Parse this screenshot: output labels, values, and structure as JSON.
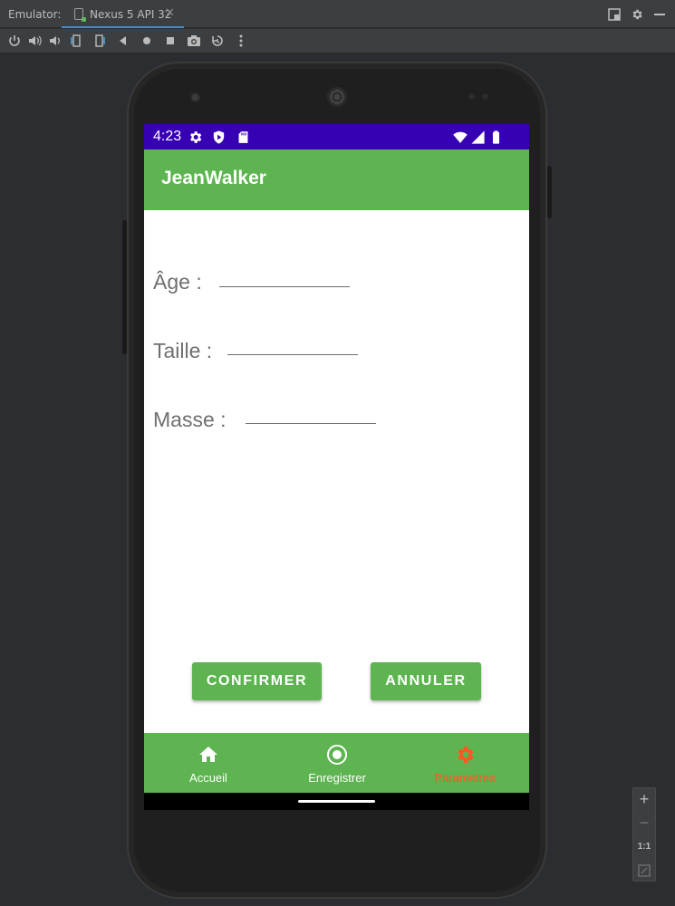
{
  "window": {
    "emulator_label": "Emulator:",
    "tab_label": "Nexus 5 API 32",
    "tab_close": "✕"
  },
  "toolbar": {
    "icons": [
      "power-icon",
      "volume-up-icon",
      "volume-down-icon",
      "rotate-left-icon",
      "rotate-right-icon",
      "back-icon",
      "home-icon",
      "overview-icon",
      "screenshot-icon",
      "snapshot-icon",
      "more-icon"
    ]
  },
  "status_bar": {
    "time": "4:23",
    "color": "#3700b3"
  },
  "app": {
    "title": "JeanWalker",
    "primary_color": "#5db450"
  },
  "form": {
    "age_label": "Âge :",
    "age_value": "",
    "taille_label": "Taille :",
    "taille_value": "",
    "masse_label": "Masse :",
    "masse_value": ""
  },
  "buttons": {
    "confirm_label": "CONFIRMER",
    "cancel_label": "ANNULER"
  },
  "bottom_nav": {
    "items": [
      {
        "label": "Accueil",
        "icon": "home-icon",
        "selected": false
      },
      {
        "label": "Enregistrer",
        "icon": "record-icon",
        "selected": false
      },
      {
        "label": "Parametres",
        "icon": "settings-gear-icon",
        "selected": true
      }
    ],
    "selected_color": "#ff5722",
    "unselected_color": "#ffffff"
  },
  "zoom": {
    "zoom_in": "+",
    "zoom_out": "−",
    "actual_size": "1:1"
  }
}
